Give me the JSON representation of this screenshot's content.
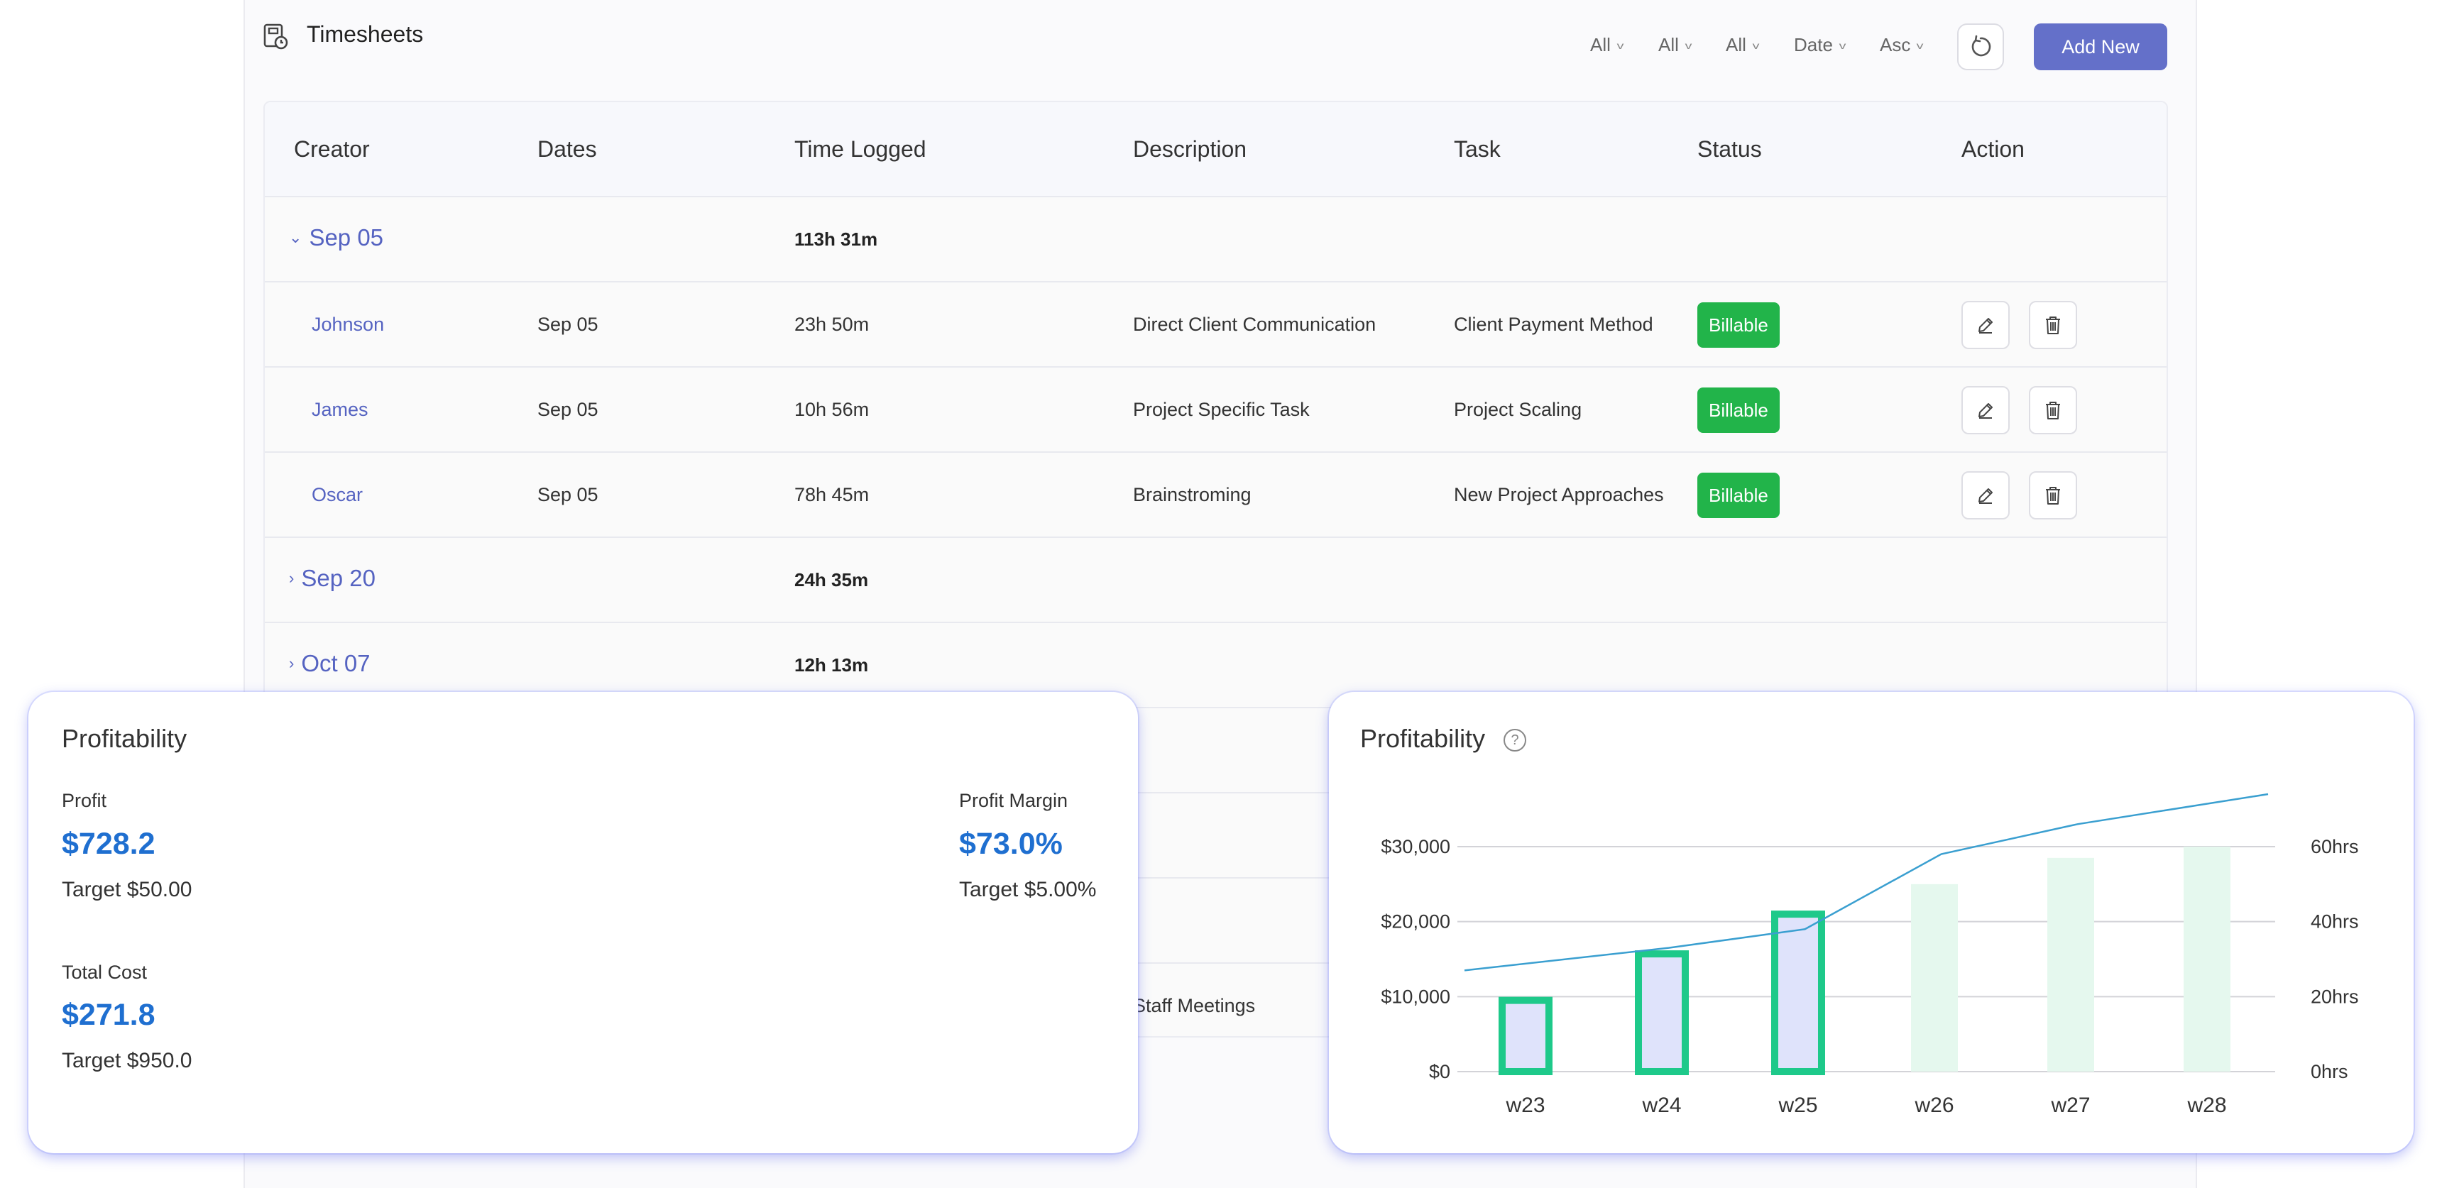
{
  "header": {
    "title": "Timesheets",
    "filters": [
      "All",
      "All",
      "All",
      "Date",
      "Asc"
    ],
    "add_button": "Add New"
  },
  "table": {
    "columns": [
      "Creator",
      "Dates",
      "Time Logged",
      "Description",
      "Task",
      "Status",
      "Action"
    ],
    "groups": [
      {
        "date": "Sep 05",
        "total": "113h 31m",
        "expanded": true,
        "rows": [
          {
            "creator": "Johnson",
            "date": "Sep 05",
            "time": "23h 50m",
            "description": "Direct Client Communication",
            "task": "Client Payment Method",
            "status": "Billable"
          },
          {
            "creator": "James",
            "date": "Sep 05",
            "time": "10h 56m",
            "description": "Project Specific Task",
            "task": "Project Scaling",
            "status": "Billable"
          },
          {
            "creator": "Oscar",
            "date": "Sep 05",
            "time": "78h 45m",
            "description": "Brainstroming",
            "task": "New Project Approaches",
            "status": "Billable"
          }
        ]
      },
      {
        "date": "Sep 20",
        "total": "24h 35m",
        "expanded": false
      },
      {
        "date": "Oct 07",
        "total": "12h 13m",
        "expanded": false
      }
    ],
    "partial_description": "Staff Meetings"
  },
  "profit_card": {
    "title": "Profitability",
    "profit_label": "Profit",
    "profit_value": "$728.2",
    "profit_target": "Target $50.00",
    "margin_label": "Profit Margin",
    "margin_value": "$73.0%",
    "margin_target": "Target $5.00%",
    "cost_label": "Total Cost",
    "cost_value": "$271.8",
    "cost_target": "Target $950.0"
  },
  "chart_card": {
    "title": "Profitability",
    "help_icon": "?"
  },
  "chart_data": {
    "type": "bar",
    "categories": [
      "w23",
      "w24",
      "w25",
      "w26",
      "w27",
      "w28"
    ],
    "series": [
      {
        "values": [
          9500,
          15700,
          21000,
          25000,
          28500,
          30000
        ],
        "axis": "left",
        "style": "bar",
        "actual": [
          true,
          true,
          true,
          false,
          false,
          false
        ]
      },
      {
        "values": [
          27,
          33,
          38,
          58,
          66,
          74
        ],
        "axis": "right",
        "style": "line"
      }
    ],
    "left_axis": {
      "ticks": [
        "$0",
        "$10,000",
        "$20,000",
        "$30,000"
      ],
      "tick_values": [
        0,
        10000,
        20000,
        30000
      ]
    },
    "right_axis": {
      "ticks": [
        "0hrs",
        "20hrs",
        "40hrs",
        "60hrs"
      ],
      "tick_values": [
        0,
        20,
        40,
        60
      ]
    },
    "colors": {
      "actual_border": "#1ec98a",
      "actual_fill": "#dfe3fb",
      "forecast_fill": "#e5f8ee",
      "line": "#3a9fd0",
      "grid": "#d3d3d8"
    }
  }
}
